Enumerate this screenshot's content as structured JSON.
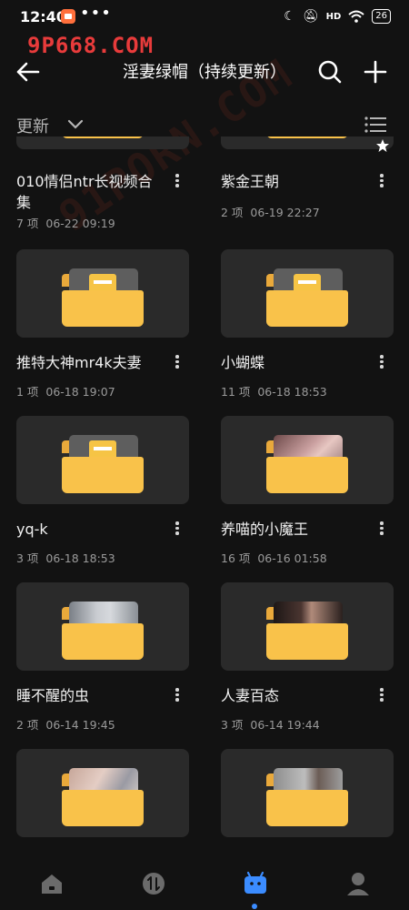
{
  "status_bar": {
    "time": "12:40",
    "more": "•••",
    "signal": "HD",
    "battery": "26"
  },
  "watermark": {
    "top": "9P668.COM",
    "diagonal": "91PORN.COM"
  },
  "header": {
    "title": "淫妻绿帽（持续更新）"
  },
  "sort": {
    "label": "更新"
  },
  "folders": [
    {
      "name": "",
      "count": "",
      "date": "",
      "thumb": "folder"
    },
    {
      "name": "",
      "count": "",
      "date": "",
      "thumb": "folder"
    },
    {
      "name": "010情侣ntr长视频合集",
      "count": "7 项",
      "date": "06-22 09:19",
      "thumb": "folder"
    },
    {
      "name": "紫金王朝",
      "count": "2 项",
      "date": "06-19 22:27",
      "thumb": "folder"
    },
    {
      "name": "推特大神mr4k夫妻",
      "count": "1 项",
      "date": "06-18 19:07",
      "thumb": "folder"
    },
    {
      "name": "小蝴蝶",
      "count": "11 项",
      "date": "06-18 18:53",
      "thumb": "folder"
    },
    {
      "name": "yq-k",
      "count": "3 项",
      "date": "06-18 18:53",
      "thumb": "folder"
    },
    {
      "name": "养喵的小魔王",
      "count": "16 项",
      "date": "06-16 01:58",
      "thumb": "photo-skin"
    },
    {
      "name": "睡不醒的虫",
      "count": "2 项",
      "date": "06-14 19:45",
      "thumb": "photo-room"
    },
    {
      "name": "人妻百态",
      "count": "3 项",
      "date": "06-14 19:44",
      "thumb": "photo-dark"
    },
    {
      "name": "",
      "count": "",
      "date": "",
      "thumb": "photo-bed"
    },
    {
      "name": "",
      "count": "",
      "date": "",
      "thumb": "photo-gray"
    }
  ],
  "bottom_nav": {
    "items": [
      "home-icon",
      "transfer-icon",
      "drive-icon",
      "profile-icon"
    ],
    "active": "drive-icon"
  },
  "colors": {
    "background": "#121212",
    "card": "#2a2a2a",
    "folder": "#f9c24a",
    "accent": "#3b8cff"
  }
}
